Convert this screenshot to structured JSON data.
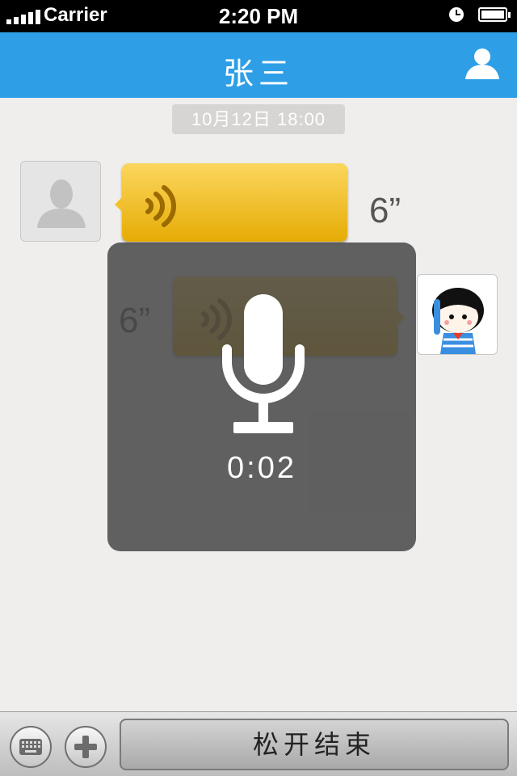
{
  "status_bar": {
    "carrier": "Carrier",
    "time": "2:20 PM",
    "icons": [
      "signal-icon",
      "clock-icon",
      "battery-icon"
    ]
  },
  "nav": {
    "title": "张三",
    "contact_icon": "contact-person-icon"
  },
  "chat": {
    "timestamp": "10月12日 18:00",
    "messages": [
      {
        "side": "left",
        "type": "voice",
        "duration": "6”",
        "avatar": "default-avatar-icon"
      },
      {
        "side": "right",
        "type": "voice",
        "duration": "6”",
        "avatar": "cartoon-girl-avatar"
      }
    ]
  },
  "recording": {
    "icon": "microphone-icon",
    "elapsed": "0:02"
  },
  "toolbar": {
    "keyboard_icon": "keyboard-icon",
    "plus_icon": "plus-icon",
    "talk_button_label": "松开结束"
  },
  "colors": {
    "nav_bar": "#2e9fe6",
    "bubble": "#f3c02a",
    "background": "#f0eeed",
    "overlay": "#464646"
  }
}
